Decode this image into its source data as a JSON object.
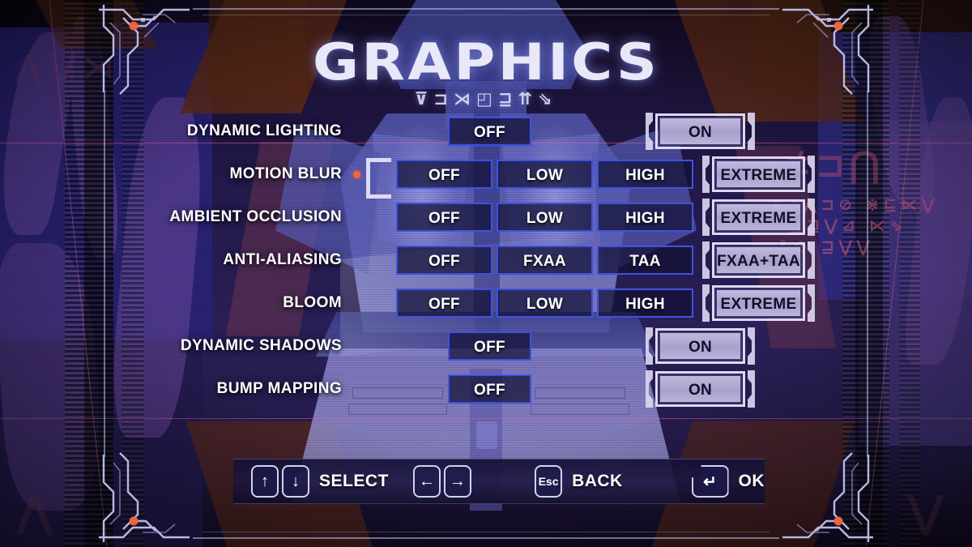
{
  "screen": {
    "title": "GRAPHICS",
    "subtitle_glyphs": "⊽⊐⋊◰⊒⇈⇘",
    "accent_color": "#3f52e0",
    "selected_fill": "#b5acd6",
    "cursor_dot_color": "#f2663c"
  },
  "settings": [
    {
      "label": "DYNAMIC LIGHTING",
      "type": "toggle",
      "options": [
        "OFF",
        "ON"
      ],
      "selected_index": 1,
      "row_focused": false
    },
    {
      "label": "MOTION BLUR",
      "type": "quality",
      "options": [
        "OFF",
        "LOW",
        "HIGH",
        "EXTREME"
      ],
      "selected_index": 3,
      "row_focused": true
    },
    {
      "label": "AMBIENT OCCLUSION",
      "type": "quality",
      "options": [
        "OFF",
        "LOW",
        "HIGH",
        "EXTREME"
      ],
      "selected_index": 3,
      "row_focused": false
    },
    {
      "label": "ANTI-ALIASING",
      "type": "quality",
      "options": [
        "OFF",
        "FXAA",
        "TAA",
        "FXAA+TAA"
      ],
      "selected_index": 3,
      "row_focused": false
    },
    {
      "label": "BLOOM",
      "type": "quality",
      "options": [
        "OFF",
        "LOW",
        "HIGH",
        "EXTREME"
      ],
      "selected_index": 3,
      "row_focused": false
    },
    {
      "label": "DYNAMIC SHADOWS",
      "type": "toggle",
      "options": [
        "OFF",
        "ON"
      ],
      "selected_index": 1,
      "row_focused": false
    },
    {
      "label": "BUMP MAPPING",
      "type": "toggle",
      "options": [
        "OFF",
        "ON"
      ],
      "selected_index": 1,
      "row_focused": false
    }
  ],
  "footer": [
    {
      "keys": [
        "↑",
        "↓"
      ],
      "label": "SELECT"
    },
    {
      "keys": [
        "←",
        "→"
      ],
      "label": ""
    },
    {
      "keys": [
        "Esc"
      ],
      "label": "BACK"
    },
    {
      "keys": [
        "↵"
      ],
      "label": "OK"
    }
  ],
  "decor": {
    "glyph_large": "⊄⊐⋂",
    "glyph_line1": "⇙⇙⋀⊐⊘ ⋇⊑⋉⋁",
    "glyph_line2": "⇘⊑⊒⋁⊿ ⋉⇘",
    "glyph_line3": "⇓⊘ ⊒⋁⋁",
    "glyph_left": "⋀⋁⋊",
    "faint_left": "⋀",
    "faint_right": "⋁"
  }
}
